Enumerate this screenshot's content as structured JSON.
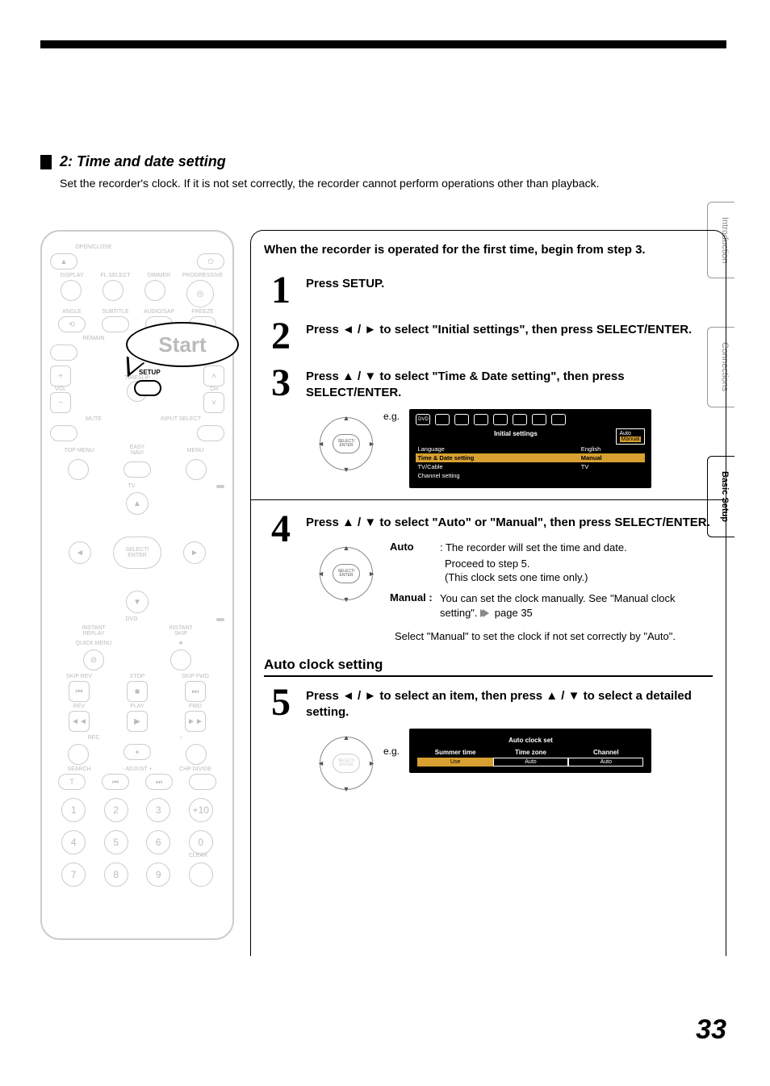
{
  "section": {
    "number": "2:",
    "title": "Time and date setting",
    "description": "Set the recorder's clock. If it is not set correctly, the recorder cannot perform operations other than playback."
  },
  "tabs": [
    "Introduction",
    "Connections",
    "Basic Setup"
  ],
  "remote": {
    "start": "Start",
    "setup_label": "SETUP",
    "labels": {
      "open_close": "OPEN/CLOSE",
      "row2": [
        "DISPLAY",
        "FL SELECT",
        "DIMMER",
        "PROGRESSIVE"
      ],
      "row3": [
        "ANGLE",
        "SUBTITLE",
        "AUDIO/SAP",
        "FREEZE"
      ],
      "vol": "VOL",
      "ch": "CH",
      "timeslip": "TIMESLIP",
      "remain": "REMAIN",
      "mute": "MUTE",
      "input_select": "INPUT SELECT",
      "top_menu": "TOP MENU",
      "easy_navi": "EASY\nNAVI",
      "menu": "MENU",
      "select_enter": "SELECT/\nENTER",
      "tv": "TV",
      "dvd": "DVD",
      "instant_replay": "INSTANT\nREPLAY",
      "instant_skip": "INSTANT\nSKIP",
      "quick_menu": "QUICK MENU",
      "skip_rev": "SKIP REV",
      "stop": "STOP",
      "skip_fwd": "SKIP FWD",
      "rev": "REV",
      "play": "PLAY",
      "fwd": "FWD",
      "rec": "REC",
      "search": "SEARCH",
      "adjust": "- ADJUST +",
      "chp_divide": "CHP DIVIDE",
      "clear": "CLEAR"
    },
    "numbers": [
      "1",
      "2",
      "3",
      "+10",
      "4",
      "5",
      "6",
      "0",
      "7",
      "8",
      "9",
      ""
    ]
  },
  "steps": {
    "intro": "When the recorder is operated for the first time, begin from step 3.",
    "s1": {
      "n": "1",
      "t": "Press SETUP."
    },
    "s2": {
      "n": "2",
      "t": "Press ◄ / ► to select \"Initial settings\", then press SELECT/ENTER."
    },
    "s3": {
      "n": "3",
      "t": "Press ▲ / ▼ to select \"Time & Date setting\", then press SELECT/ENTER.",
      "eg": "e.g.",
      "osd": {
        "title": "Initial settings",
        "rows": [
          [
            "Language",
            "English"
          ],
          [
            "Time & Date setting",
            "Manual"
          ],
          [
            "TV/Cable",
            "TV"
          ],
          [
            "Channel setting",
            ""
          ]
        ],
        "side": [
          "Auto",
          "Manual"
        ]
      }
    },
    "s4": {
      "n": "4",
      "t": "Press ▲ / ▼ to select \"Auto\" or \"Manual\", then press SELECT/ENTER.",
      "auto_k": "Auto",
      "auto_v1": ": The recorder will set the time and date.",
      "auto_v2": "Proceed to step 5.",
      "auto_v3": "(This clock sets one time only.)",
      "manual_k": "Manual :",
      "manual_v": "You can set the clock manually. See \"Manual clock setting\".",
      "page_ref": "page 35",
      "note": "Select \"Manual\" to set the clock if not set correctly by \"Auto\"."
    },
    "auto_head": "Auto clock setting",
    "s5": {
      "n": "5",
      "t": "Press ◄ / ► to select an item, then press ▲ / ▼ to select a detailed setting.",
      "eg": "e.g.",
      "osd": {
        "title": "Auto clock set",
        "cols": [
          {
            "h": "Summer time",
            "v": "Use"
          },
          {
            "h": "Time zone",
            "v": "Auto"
          },
          {
            "h": "Channel",
            "v": "Auto"
          }
        ]
      }
    }
  },
  "nav_center": "SELECT/\nENTER",
  "page_number": "33"
}
